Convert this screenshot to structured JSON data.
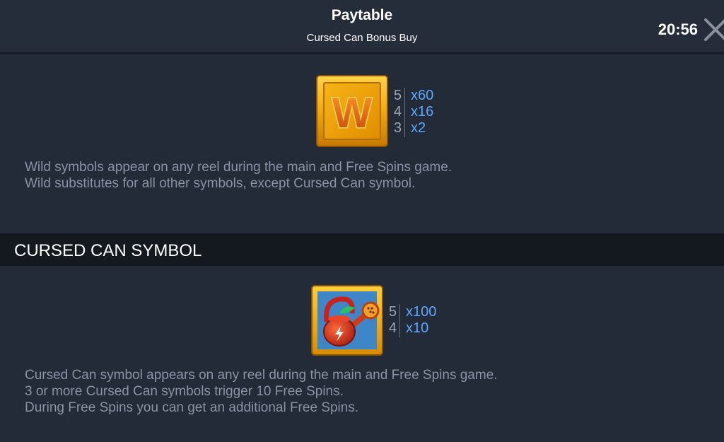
{
  "header": {
    "title": "Paytable",
    "subtitle": "Cursed Can Bonus Buy",
    "clock": "20:56",
    "close_icon": "close-icon"
  },
  "wild": {
    "icon": "wild-symbol-icon",
    "icon_letter": "W",
    "payouts": [
      {
        "count": "5",
        "multiplier": "x60"
      },
      {
        "count": "4",
        "multiplier": "x16"
      },
      {
        "count": "3",
        "multiplier": "x2"
      }
    ],
    "description": [
      "Wild symbols appear on any reel during the main and Free Spins game.",
      "Wild substitutes for all other symbols, except Cursed Can symbol."
    ]
  },
  "cursed_can": {
    "section_title": "CURSED CAN SYMBOL",
    "icon": "watering-can-icon",
    "payouts": [
      {
        "count": "5",
        "multiplier": "x100"
      },
      {
        "count": "4",
        "multiplier": "x10"
      }
    ],
    "description": [
      "Cursed Can symbol appears on any reel during the main and Free Spins game.",
      "3 or more Cursed Can symbols trigger 10 Free Spins.",
      "During Free Spins you can get an additional Free Spins."
    ]
  },
  "colors": {
    "background": "#232a38",
    "section_bar": "#14181f",
    "multiplier_blue": "#5ca8ff",
    "description_gray": "#8a93a6",
    "gold": "#f2b20a"
  }
}
